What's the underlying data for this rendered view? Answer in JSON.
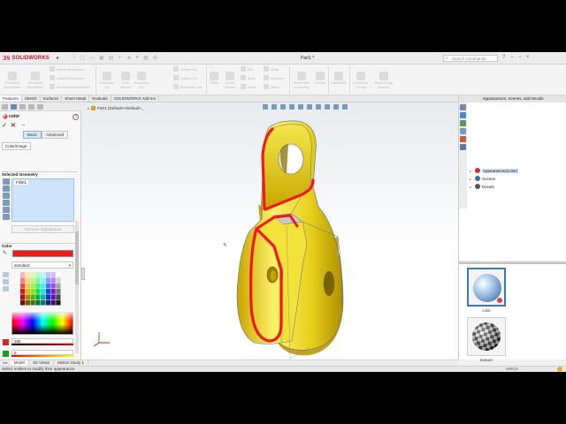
{
  "app": {
    "logo_ds": "3S",
    "logo_text": "SOLIDWORKS",
    "doc_title": "Part1 *",
    "search_placeholder": "Search Commands"
  },
  "ribbon": {
    "large_buttons": [
      "Extruded Boss/Base",
      "Revolved Boss/Base",
      "Extruded Cut",
      "Hole Wizard",
      "Revolved Cut",
      "Fillet",
      "Linear Pattern",
      "Reference Geometry",
      "Curves",
      "Instant3D",
      "Contents Thread",
      "Mesh/Copy Bodies"
    ],
    "small_rows": [
      "Swept Boss/Base",
      "Lofted Boss/Base",
      "Boundary Boss/Base",
      "Swept Cut",
      "Lofted Cut",
      "Boundary Cut",
      "Rib",
      "Draft",
      "Shell",
      "Wrap",
      "Intersect",
      "Mirror"
    ]
  },
  "tabs": [
    "Features",
    "Sketch",
    "Surfaces",
    "Sheet Metal",
    "Evaluate",
    "SOLIDWORKS Add-Ins"
  ],
  "active_tab": "Features",
  "property_manager": {
    "title": "color",
    "mode_tabs": [
      "Basic",
      "Advanced"
    ],
    "active_mode": "Basic",
    "subtab": "Color/Image",
    "selected_geometry_title": "Selected Geometry",
    "selected_items": [
      "Fillet1"
    ],
    "remove_button": "Remove Appearance",
    "color_section_title": "Color",
    "color_value": "#ee1b1b",
    "palette_select": "standard",
    "channels": [
      {
        "value": "255",
        "color": "#e02020"
      },
      {
        "value": "0",
        "color": "#1aa01a"
      }
    ]
  },
  "graphics": {
    "tree_label": "Part1 (Default<<Default>_"
  },
  "task_pane": {
    "title": "Appearances, Scenes, and Decals",
    "tree": [
      {
        "label": "Appearances(color)",
        "selected": true,
        "icon_color": "#d03030"
      },
      {
        "label": "Scenes",
        "selected": false,
        "icon_color": "#3a6fb0"
      },
      {
        "label": "Decals",
        "selected": false,
        "icon_color": "#555555"
      }
    ],
    "thumbnails": [
      {
        "label": "color",
        "selected": true
      },
      {
        "label": "texture",
        "selected": false
      }
    ]
  },
  "bottom_tabs": [
    "Model",
    "3D Views",
    "Motion Study 1"
  ],
  "active_bottom_tab": "Model",
  "status": {
    "text": "Select entities to modify their appearance",
    "units": "MMGS"
  }
}
